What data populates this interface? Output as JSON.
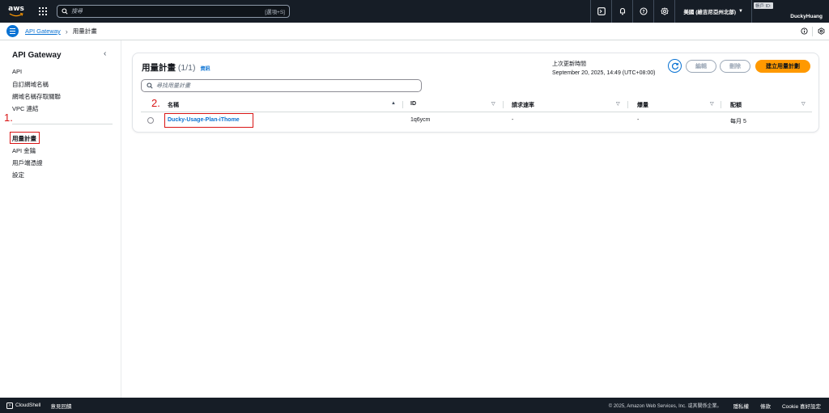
{
  "topnav": {
    "logo_text": "aws",
    "search_placeholder": "搜尋",
    "search_shortcut": "[選項+S]",
    "region": "美國 (維吉尼亞州北部)",
    "account_label": "帳戶 ID: ",
    "username": "DuckyHuang"
  },
  "breadcrumb": {
    "service": "API Gateway",
    "current": "用量計畫"
  },
  "sidebar": {
    "title": "API Gateway",
    "items_top": [
      "API",
      "自訂網域名稱",
      "網域名稱存取關聯",
      "VPC 連結"
    ],
    "items_bottom": [
      "用量計畫",
      "API 金鑰",
      "用戶端憑證",
      "設定"
    ]
  },
  "annotations": {
    "step1": "1.",
    "step2": "2."
  },
  "panel": {
    "title": "用量計畫",
    "count": "(1/1)",
    "info": "資訊",
    "last_updated_label": "上次更新時間",
    "last_updated_value": "September 20, 2025, 14:49 (UTC+08:00)",
    "edit_label": "編輯",
    "delete_label": "刪除",
    "create_label": "建立用量計劃",
    "search_placeholder": "尋找用量計畫",
    "columns": [
      "名稱",
      "ID",
      "請求速率",
      "爆量",
      "配額"
    ],
    "rows": [
      {
        "name": "Ducky-Usage-Plan-iThome",
        "id": "1q6ycm",
        "rate": "-",
        "burst": "-",
        "quota": "每月 5"
      }
    ]
  },
  "footer": {
    "cloudshell": "CloudShell",
    "feedback": "意見回饋",
    "copyright": "© 2025, Amazon Web Services, Inc. 或其關係企業。",
    "privacy": "隱私權",
    "terms": "條款",
    "cookie": "Cookie 喜好設定"
  },
  "colors": {
    "brand_blue": "#0972d3",
    "primary_orange": "#ff9900",
    "nav_dark": "#161d26",
    "annotation_red": "#d91515"
  }
}
